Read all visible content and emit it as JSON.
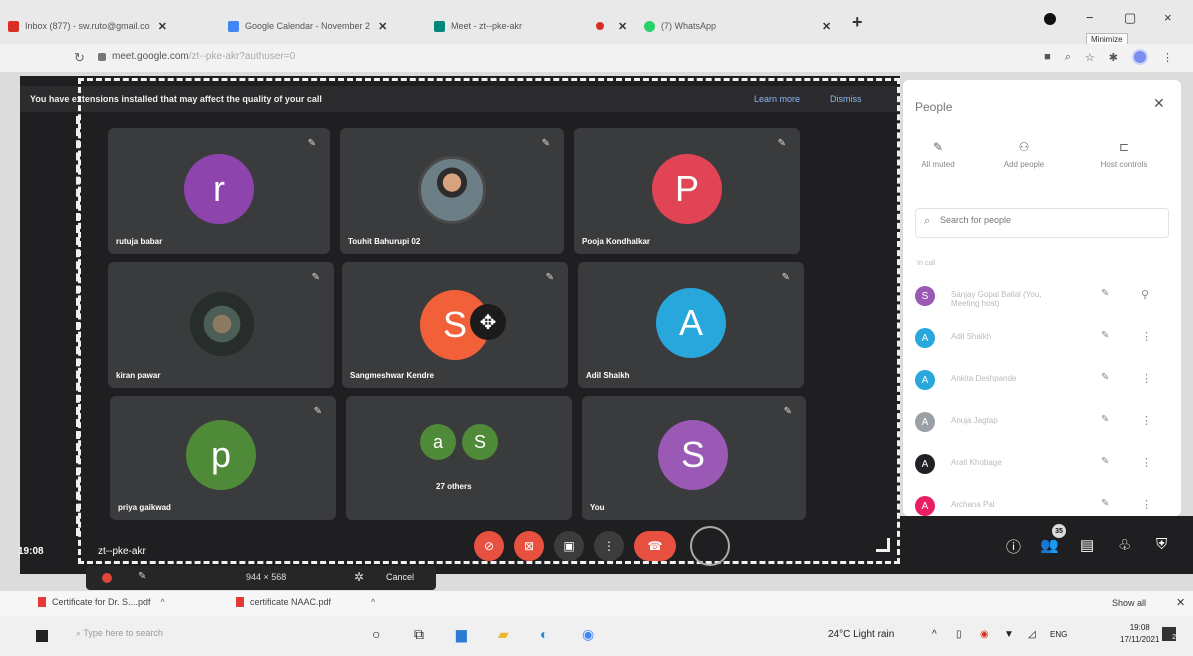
{
  "browser": {
    "tabs": [
      {
        "title": "Inbox (877) - sw.ruto@gmail.co",
        "color": "#d93025"
      },
      {
        "title": "Google Calendar - November 2",
        "color": "#4285f4"
      },
      {
        "title": "Meet - zt--pke-akr",
        "color": "#00897b"
      },
      {
        "title": "",
        "color": "#d93025"
      },
      {
        "title": "(7) WhatsApp",
        "color": "#25d366"
      }
    ],
    "new_tab": "+",
    "tooltip": "Minimize",
    "url": "meet.google.com",
    "url_rest": "/zt--pke-akr?authuser=0",
    "win_close": "×",
    "win_minimize": "−",
    "win_restore": "▢"
  },
  "meet": {
    "banner_message": "You have extensions installed that may affect the quality of your call",
    "learn_more": "Learn more",
    "dismiss": "Dismiss",
    "time": "19:08",
    "meeting_code": "zt--pke-akr",
    "participants": [
      {
        "name": "rutuja babar",
        "initial": "r",
        "color": "#8e44ad"
      },
      {
        "name": "Touhit Bahurupi 02",
        "initial": "",
        "color": ""
      },
      {
        "name": "Pooja Kondhalkar",
        "initial": "P",
        "color": "#e04455"
      },
      {
        "name": "kiran pawar",
        "initial": "",
        "color": ""
      },
      {
        "name": "Sangmeshwar Kendre",
        "initial": "S",
        "color": "#f2603a"
      },
      {
        "name": "Adil Shaikh",
        "initial": "A",
        "color": "#27a7dc"
      },
      {
        "name": "priya gaikwad",
        "initial": "p",
        "color": "#4e8a37"
      },
      {
        "name": "You",
        "initial": "S",
        "color": "#9b59b6"
      }
    ],
    "others": {
      "label": "27 others",
      "initials": [
        "a",
        "S"
      ]
    },
    "participant_count": "35"
  },
  "people_panel": {
    "title": "People",
    "actions": [
      "All muted",
      "Add people",
      "Host controls"
    ],
    "search_placeholder": "Search for people",
    "section_label": "In call",
    "people": [
      {
        "name": "Sanjay Gopal Ballal (You, Meeting host)",
        "initial": "S",
        "color": "#9b59b6"
      },
      {
        "name": "Adil Shaikh",
        "initial": "A",
        "color": "#27a7dc"
      },
      {
        "name": "Ankita Deshpande",
        "initial": "A",
        "color": "#27a7dc"
      },
      {
        "name": "Anuja Jagtap",
        "initial": "A",
        "color": "#9aa0a6"
      },
      {
        "name": "Arati Khobage",
        "initial": "A",
        "color": "#202124"
      },
      {
        "name": "Archana Pal",
        "initial": "A",
        "color": "#e91e63"
      }
    ]
  },
  "share_bar": {
    "dimensions": "944 × 568",
    "cancel": "Cancel"
  },
  "downloads": {
    "files": [
      "Certificate for Dr. S....pdf",
      "certificate NAAC.pdf"
    ],
    "show_all": "Show all"
  },
  "taskbar": {
    "search_placeholder": "Type here to search",
    "weather": "24°C  Light rain",
    "language": "ENG",
    "clock_time": "19:08",
    "clock_date": "17/11/2021",
    "notifications": "2"
  }
}
